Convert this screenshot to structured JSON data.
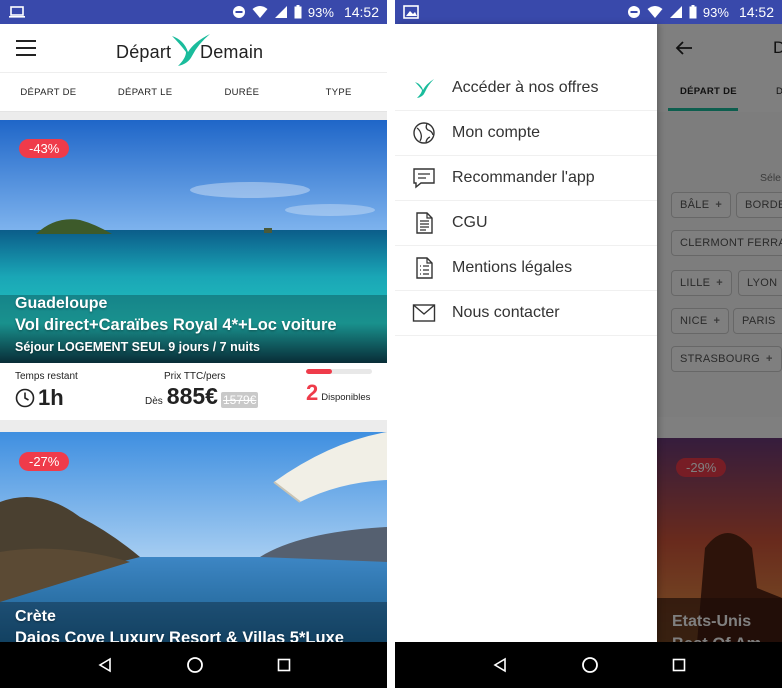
{
  "status_bar": {
    "battery": "93%",
    "time": "14:52"
  },
  "left_phone": {
    "logo": {
      "part1": "Départ",
      "part2": "Demain"
    },
    "filter_tabs": [
      "DÉPART DE",
      "DÉPART LE",
      "DURÉE",
      "TYPE"
    ],
    "offers": [
      {
        "discount": "-43%",
        "destination": "Guadeloupe",
        "title": "Vol direct+Caraïbes Royal 4*+Loc voiture",
        "subtitle": "Séjour LOGEMENT SEUL 9 jours / 7 nuits",
        "time_left_label": "Temps restant",
        "time_left": "1h",
        "price_label": "Prix TTC/pers",
        "price_prefix": "Dès",
        "price": "885€",
        "old_price": "1579€",
        "available_count": "2",
        "available_label": "Disponibles",
        "availability_fraction": 0.4
      },
      {
        "discount": "-27%",
        "destination": "Crète",
        "title": "Daios Cove Luxury Resort & Villas 5*Luxe"
      }
    ]
  },
  "right_phone": {
    "drawer_items": [
      {
        "label": "Accéder à nos offres",
        "icon": "bird-icon"
      },
      {
        "label": "Mon compte",
        "icon": "globe-icon"
      },
      {
        "label": "Recommander l'app",
        "icon": "chat-icon"
      },
      {
        "label": "CGU",
        "icon": "document-icon"
      },
      {
        "label": "Mentions légales",
        "icon": "list-document-icon"
      },
      {
        "label": "Nous contacter",
        "icon": "envelope-icon"
      }
    ],
    "background": {
      "title_letter": "D",
      "tab_active": "DÉPART DE",
      "tab_next": "D",
      "select_hint": "Séle",
      "chips": [
        "BÂLE",
        "BORDE",
        "CLERMONT FERRA",
        "LILLE",
        "LYON",
        "NICE",
        "PARIS",
        "STRASBOURG"
      ],
      "offer": {
        "discount": "-29%",
        "destination": "Etats-Unis",
        "title": "Best Of Am"
      }
    }
  },
  "colors": {
    "status_bar": "#3949ab",
    "accent": "#1abc9c",
    "discount": "#ef3b4a"
  }
}
